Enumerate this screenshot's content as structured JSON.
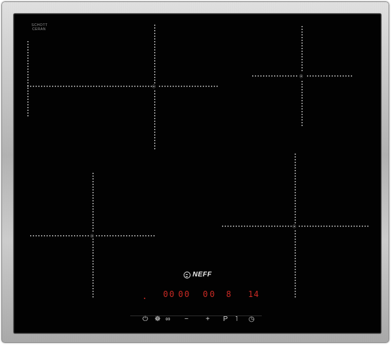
{
  "hob": {
    "glass_brand_line1": "SCHOTT",
    "glass_brand_line2": "CERAN",
    "logo_text": "NEFF",
    "zones": [
      {
        "id": "rear-left",
        "shape": "cross"
      },
      {
        "id": "rear-right",
        "shape": "cross"
      },
      {
        "id": "front-left",
        "shape": "cross"
      },
      {
        "id": "front-right",
        "shape": "cross"
      }
    ],
    "colors": {
      "glass": "#020202",
      "frame": "#bfbfbf",
      "marking": "#e0e0e0",
      "display_red": "#c92a24"
    }
  },
  "displays": {
    "zone_1": "0",
    "zone_2": "0",
    "zone_3": "0",
    "zone_4": "0",
    "zone_5": "0",
    "zone_6": "0",
    "power_level": "8",
    "timer": "14"
  },
  "controls": [
    {
      "name": "power-button",
      "label": "⏻",
      "icon": "power-icon"
    },
    {
      "name": "childlock-button",
      "label": "☸",
      "icon": "key-icon"
    },
    {
      "name": "keep-warm-button",
      "label": "∞",
      "icon": "infinity-icon"
    },
    {
      "name": "minus-button",
      "label": "−",
      "icon": "minus-icon"
    },
    {
      "name": "plus-button",
      "label": "+",
      "icon": "plus-icon"
    },
    {
      "name": "powerboost-button",
      "label": "P",
      "icon": "powerboost-icon"
    },
    {
      "name": "wipe-protection-button",
      "label": "˥",
      "icon": "wipe-icon"
    },
    {
      "name": "timer-button",
      "label": "◷",
      "icon": "timer-icon"
    }
  ]
}
